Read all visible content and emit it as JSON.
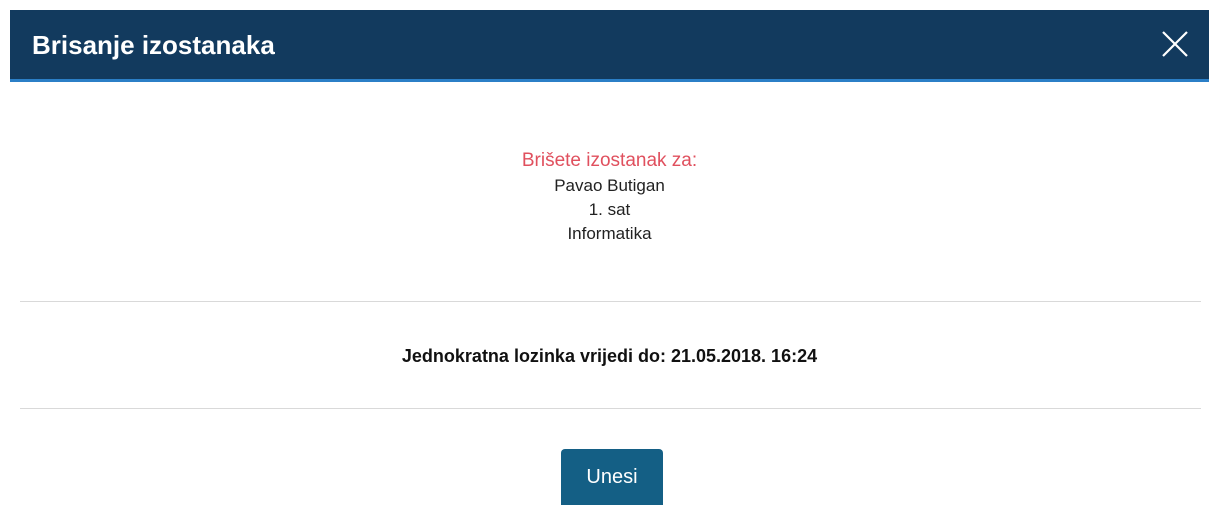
{
  "dialog": {
    "title": "Brisanje izostanaka",
    "close_icon": "close-icon"
  },
  "info": {
    "warning": "Brišete izostanak za:",
    "student": "Pavao Butigan",
    "period": "1. sat",
    "subject": "Informatika"
  },
  "otp": {
    "text": "Jednokratna lozinka vrijedi do: 21.05.2018. 16:24"
  },
  "actions": {
    "submit_label": "Unesi"
  },
  "colors": {
    "header_bg": "#123a5e",
    "header_accent": "#2b7fc7",
    "warning_text": "#e0505e",
    "button_bg": "#145f85"
  }
}
